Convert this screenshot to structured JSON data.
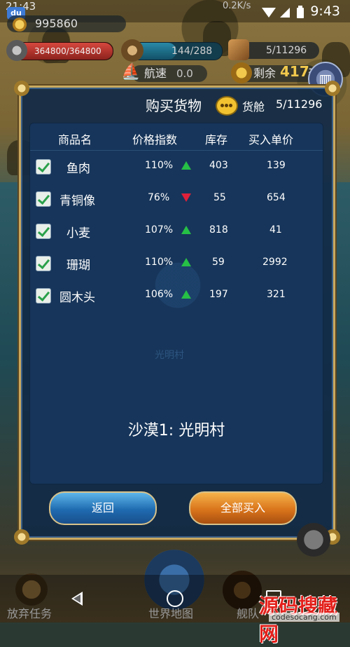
{
  "status_bar": {
    "clock_left": "21:43",
    "badge": "du",
    "network": "0.2K/s",
    "time": "9:43"
  },
  "hud": {
    "gold": "995860",
    "hp": {
      "text": "364800/364800",
      "fraction": 1.0
    },
    "sailors": {
      "text": "144/288",
      "fraction": 0.5
    },
    "cargo": "5/11296",
    "speed_label": "航速",
    "speed_value": "0.0",
    "remaining_label": "剩余",
    "remaining_value": "417",
    "remaining_unit": "天"
  },
  "dialog": {
    "title": "购买货物",
    "hold_label": "货舱",
    "hold_value": "5/11296",
    "columns": [
      "商品名",
      "价格指数",
      "库存",
      "买入单价"
    ],
    "rows": [
      {
        "name": "鱼肉",
        "index": "110%",
        "trend": "up",
        "stock": "403",
        "price": "139",
        "checked": true
      },
      {
        "name": "青铜像",
        "index": "76%",
        "trend": "down",
        "stock": "55",
        "price": "654",
        "checked": true
      },
      {
        "name": "小麦",
        "index": "107%",
        "trend": "up",
        "stock": "818",
        "price": "41",
        "checked": true
      },
      {
        "name": "珊瑚",
        "index": "110%",
        "trend": "up",
        "stock": "59",
        "price": "2992",
        "checked": true
      },
      {
        "name": "圆木头",
        "index": "106%",
        "trend": "up",
        "stock": "197",
        "price": "321",
        "checked": true
      }
    ],
    "watermark_text": "光明村",
    "location": "沙漠1: 光明村",
    "back_button": "返回",
    "buy_all_button": "全部买入"
  },
  "bottom_bar": {
    "abandon_task": "放弃任务",
    "world_map": "世界地图",
    "fleet": "舰队"
  },
  "watermark": {
    "brand": "源码搜藏网",
    "url": "codesocang.com"
  },
  "colors": {
    "trend_up": "#26c046",
    "trend_down": "#e0203a",
    "remaining_gold": "#f2c94c"
  }
}
